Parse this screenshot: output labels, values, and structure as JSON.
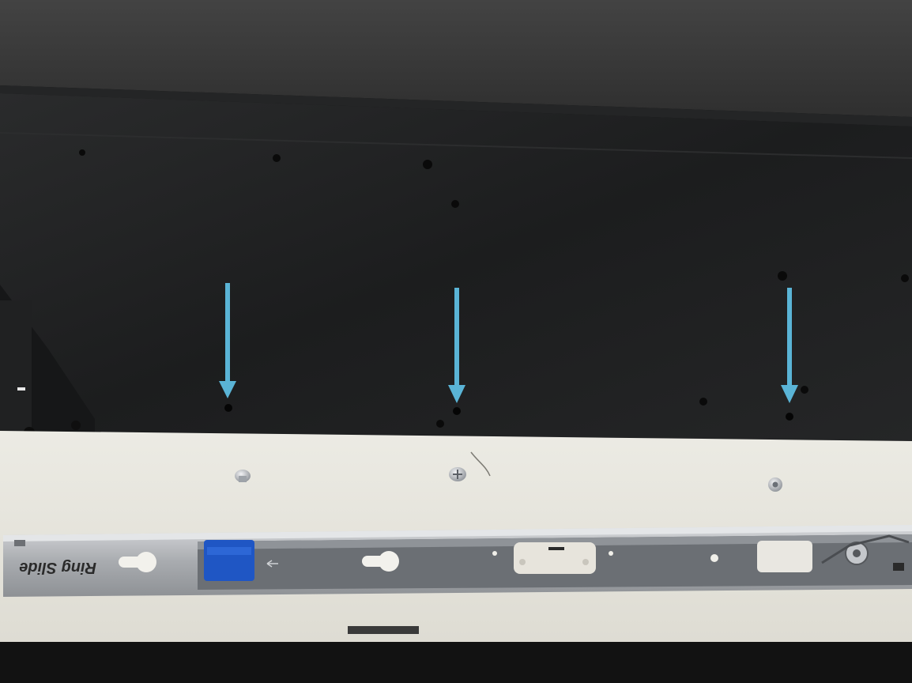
{
  "photo": {
    "subject": "server-chassis-side-with-rail",
    "colors": {
      "chassis_top": "#3b3b3b",
      "chassis_side": "#1f2021",
      "table": "#e8e6df",
      "rail_metal": "#b9bcc0",
      "arrow": "#5ab4d6",
      "blue_clip": "#1f56c4",
      "floor": "#111111"
    }
  },
  "rail": {
    "engraved_text": "Ring Slide"
  },
  "arrows": [
    {
      "name": "arrow-left"
    },
    {
      "name": "arrow-center"
    },
    {
      "name": "arrow-right"
    }
  ]
}
